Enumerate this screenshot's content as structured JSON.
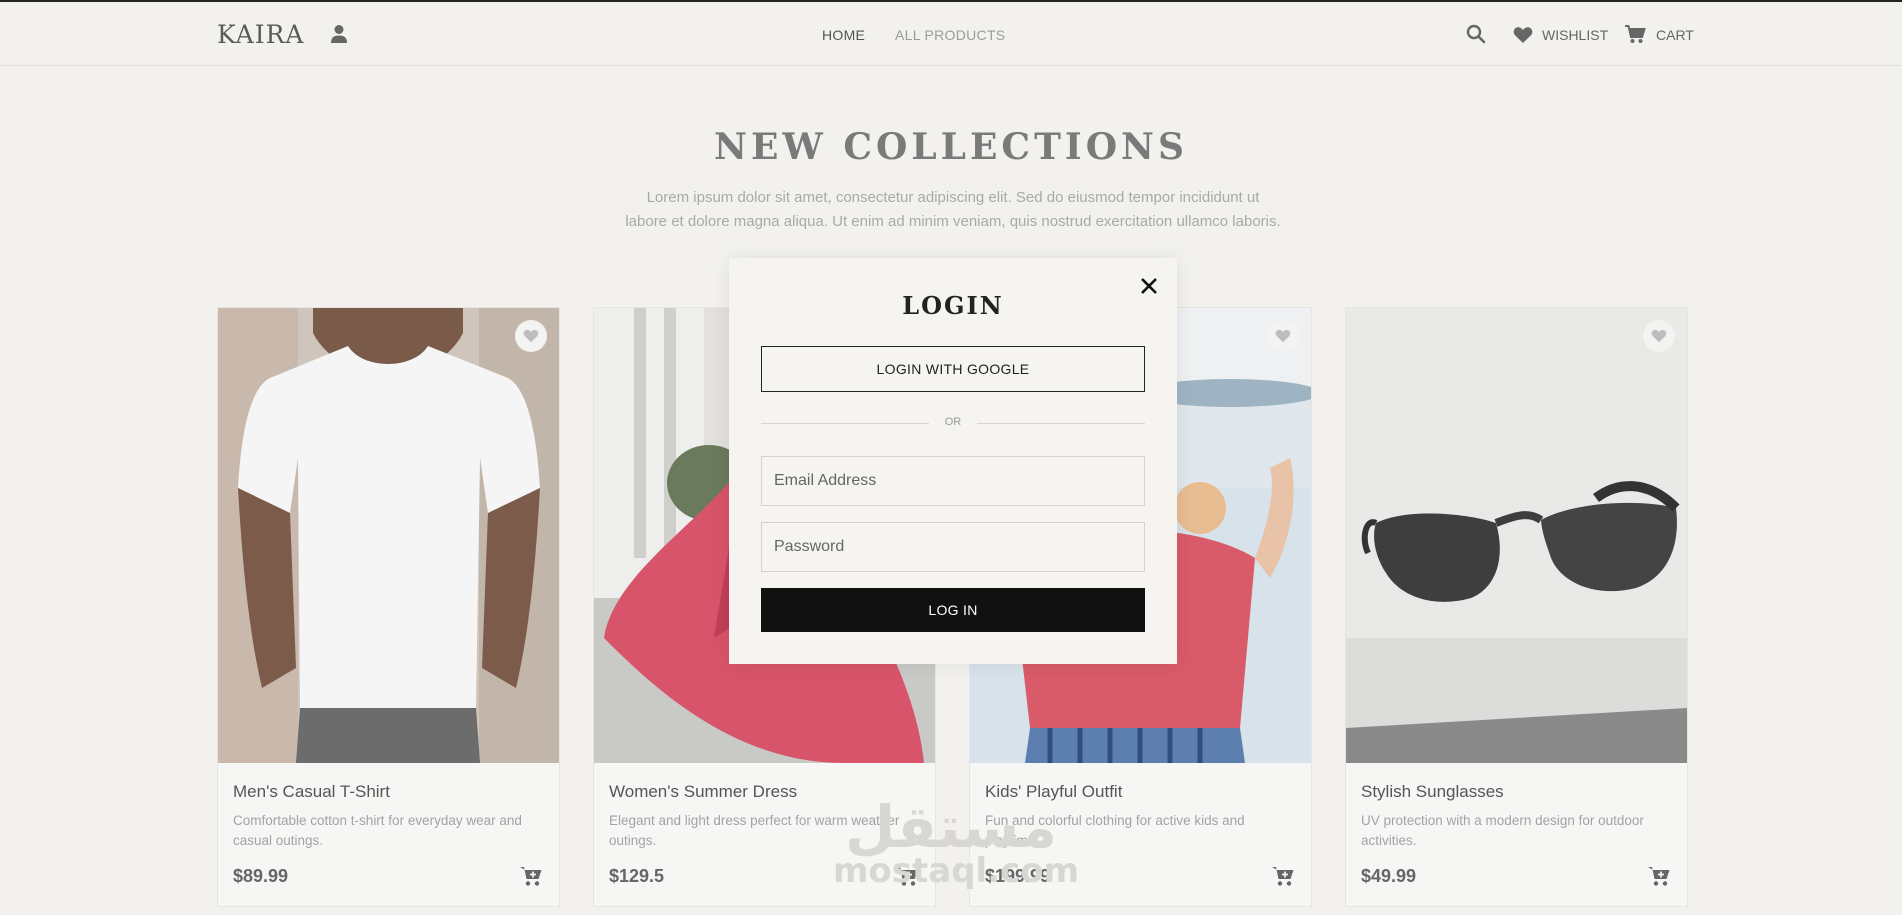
{
  "header": {
    "logo": "KAIRA",
    "nav": {
      "home": "HOME",
      "all_products": "ALL PRODUCTS"
    },
    "wishlist_label": "WISHLIST",
    "cart_label": "CART",
    "icons": [
      "user-icon",
      "search-icon",
      "heart-icon",
      "cart-icon"
    ]
  },
  "section": {
    "title": "NEW COLLECTIONS",
    "description": "Lorem ipsum dolor sit amet, consectetur adipiscing elit. Sed do eiusmod tempor incididunt ut labore et dolore magna aliqua. Ut enim ad minim veniam, quis nostrud exercitation ullamco laboris."
  },
  "products": [
    {
      "name": "Men's Casual T-Shirt",
      "description": "Comfortable cotton t-shirt for everyday wear and casual outings.",
      "price": "$89.99"
    },
    {
      "name": "Women's Summer Dress",
      "description": "Elegant and light dress perfect for warm weather outings.",
      "price": "$129.5"
    },
    {
      "name": "Kids' Playful Outfit",
      "description": "Fun and colorful clothing for active kids and playtime.",
      "price": "$199.99"
    },
    {
      "name": "Stylish Sunglasses",
      "description": "UV protection with a modern design for outdoor activities.",
      "price": "$49.99"
    }
  ],
  "login_modal": {
    "title": "LOGIN",
    "google_button": "LOGIN WITH GOOGLE",
    "divider": "OR",
    "email_placeholder": "Email Address",
    "password_placeholder": "Password",
    "submit_button": "LOG IN"
  },
  "watermark": {
    "arabic": "مستقل",
    "latin": "mostaql.com"
  },
  "colors": {
    "background": "#f2f1ee",
    "primary": "#111111",
    "muted_text": "#a3a3a3",
    "modal_bg": "#f5f4f1"
  }
}
